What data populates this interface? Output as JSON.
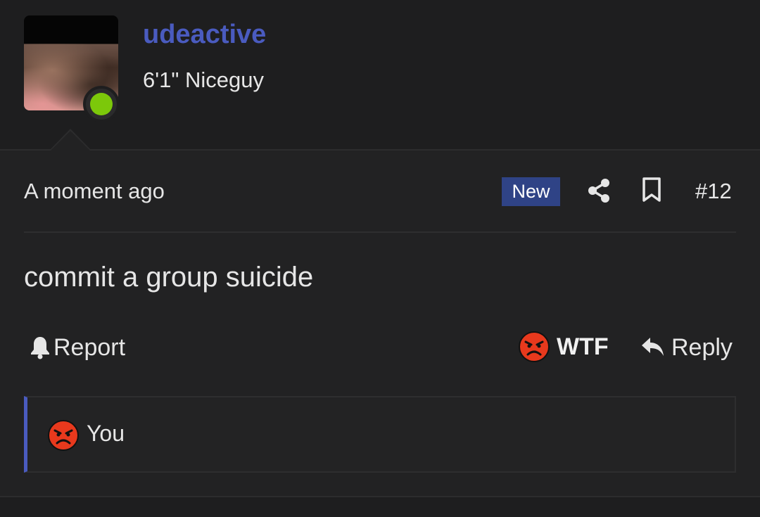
{
  "user": {
    "username": "udeactive",
    "title": "6'1\" Niceguy",
    "status_color": "#7cc80a"
  },
  "post": {
    "timestamp": "A moment ago",
    "new_badge": "New",
    "number": "#12",
    "message": "commit a group suicide"
  },
  "actions": {
    "report_label": "Report",
    "reaction_label": "WTF",
    "reply_label": "Reply"
  },
  "reactions": {
    "summary_label": "You",
    "emoji": "angry-face-icon"
  },
  "colors": {
    "accent": "#4a5bbf",
    "badge_bg": "#2f4386",
    "angry_red": "#e8391d"
  }
}
